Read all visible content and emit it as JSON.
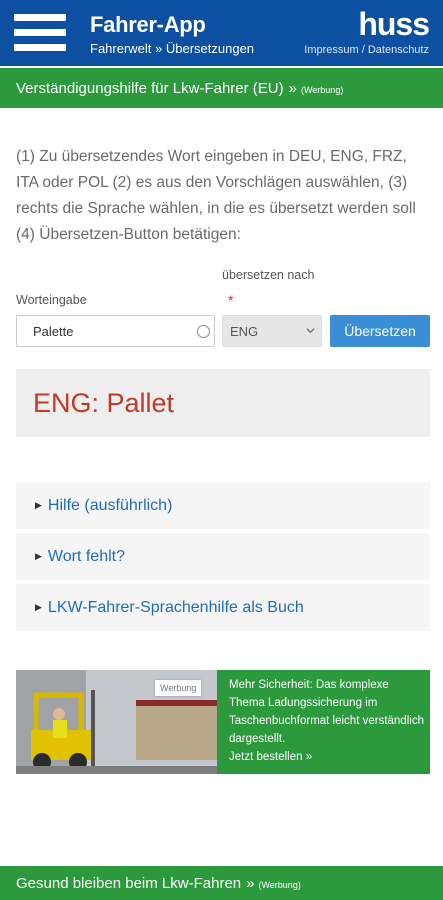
{
  "header": {
    "title": "Fahrer-App",
    "breadcrumb": "Fahrerwelt » Übersetzungen",
    "logo": "huss",
    "impressum": "Impressum / Datenschutz"
  },
  "banner_top": {
    "label": "Verständigungshilfe für Lkw-Fahrer (EU)",
    "arrow": "»",
    "tag": "(Werbung)"
  },
  "instructions": "(1) Zu übersetzendes Wort eingeben in DEU, ENG, FRZ, ITA oder POL (2) es aus den Vorschlägen auswählen, (3) rechts die Sprache wählen, in die es übersetzt werden soll (4) Übersetzen-Button betätigen:",
  "form": {
    "word_label": "Worteingabe",
    "word_value": "Palette",
    "target_label": "übersetzen nach",
    "required_mark": "*",
    "language_value": "ENG",
    "translate_button": "Übersetzen"
  },
  "result": "ENG: Pallet",
  "accordion": [
    {
      "label": "Hilfe (ausführlich)"
    },
    {
      "label": "Wort fehlt?"
    },
    {
      "label": "LKW-Fahrer-Sprachenhilfe als Buch"
    }
  ],
  "promo": {
    "tag": "Werbung",
    "text": "Mehr Sicherheit: Das komplexe Thema Ladungssicherung im Taschenbuchformat leicht verständlich dargestellt.",
    "cta": "Jetzt bestellen »"
  },
  "banner_bottom": {
    "label": "Gesund bleiben beim Lkw-Fahren",
    "arrow": "»",
    "tag": "(Werbung)"
  },
  "colors": {
    "header_blue": "#0d4fa0",
    "banner_green": "#2c9a3c",
    "button_blue": "#3a8ed6",
    "result_red": "#c0392b",
    "link_blue": "#1e6db8"
  }
}
